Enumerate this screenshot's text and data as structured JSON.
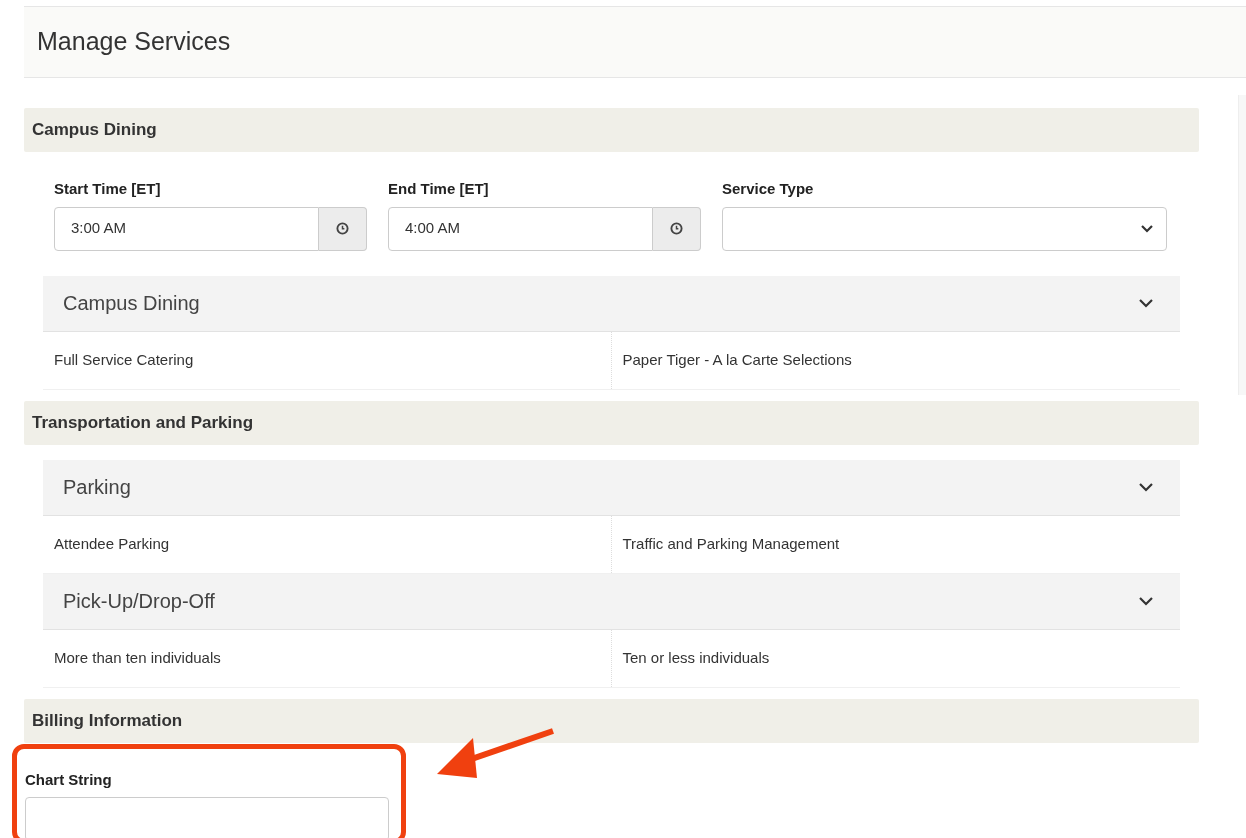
{
  "page": {
    "title": "Manage Services"
  },
  "sections": [
    {
      "title": "Campus Dining",
      "fields": [
        {
          "kind": "time",
          "label": "Start Time [ET]",
          "value": "3:00 AM"
        },
        {
          "kind": "time",
          "label": "End Time [ET]",
          "value": "4:00 AM"
        },
        {
          "kind": "select",
          "label": "Service Type"
        }
      ],
      "groups": [
        {
          "title": "Campus Dining",
          "expanded": true,
          "items": [
            "Full Service Catering",
            "Paper Tiger - A la Carte Selections"
          ]
        }
      ]
    },
    {
      "title": "Transportation and Parking",
      "groups": [
        {
          "title": "Parking",
          "expanded": true,
          "items": [
            "Attendee Parking",
            "Traffic and Parking Management"
          ]
        },
        {
          "title": "Pick-Up/Drop-Off",
          "expanded": true,
          "items": [
            "More than ten individuals",
            "Ten or less individuals"
          ]
        }
      ]
    },
    {
      "title": "Billing Information",
      "fields": [
        {
          "kind": "text",
          "label": "Chart String"
        }
      ]
    }
  ]
}
